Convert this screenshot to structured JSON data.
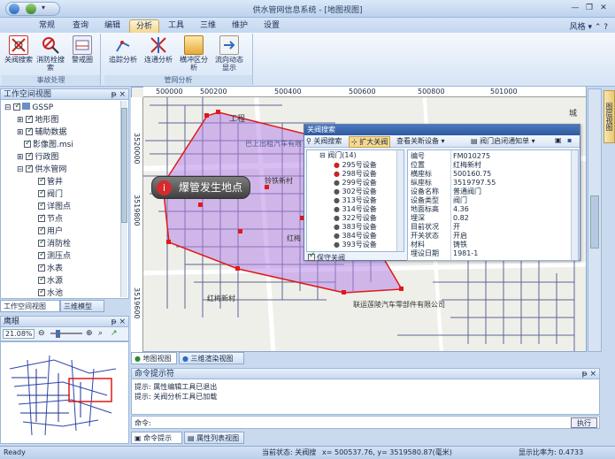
{
  "window": {
    "title": "供水管网信息系统 - [地图视图]",
    "style_label": "风格",
    "controls": [
      "—",
      "❐",
      "✕"
    ]
  },
  "menu": {
    "tabs": [
      "常规",
      "查询",
      "编辑",
      "分析",
      "工具",
      "三维",
      "维护",
      "设置"
    ],
    "active": "分析"
  },
  "ribbon": {
    "groups": [
      {
        "label": "事故处理",
        "buttons": [
          "关阀搜索",
          "消防栓搜索",
          "警戒圈"
        ]
      },
      {
        "label": "管网分析",
        "buttons": [
          "追踪分析",
          "连通分析",
          "横冲区分析",
          "流向动态显示"
        ]
      }
    ]
  },
  "workspace": {
    "title": "工作空间视图",
    "tree": [
      {
        "label": "GSSP",
        "level": 0
      },
      {
        "label": "地形图",
        "level": 1
      },
      {
        "label": "辅助数据",
        "level": 1
      },
      {
        "label": "影像图.msi",
        "level": 1
      },
      {
        "label": "行政图",
        "level": 1
      },
      {
        "label": "供水管网",
        "level": 1
      },
      {
        "label": "管井",
        "level": 2
      },
      {
        "label": "阀门",
        "level": 2
      },
      {
        "label": "详图点",
        "level": 2
      },
      {
        "label": "节点",
        "level": 2
      },
      {
        "label": "用户",
        "level": 2
      },
      {
        "label": "消防栓",
        "level": 2
      },
      {
        "label": "测压点",
        "level": 2
      },
      {
        "label": "水表",
        "level": 2
      },
      {
        "label": "水源",
        "level": 2
      },
      {
        "label": "水池",
        "level": 2
      }
    ],
    "tabs": [
      "工作空间视图",
      "三维模型"
    ]
  },
  "eagle": {
    "title": "鹰眼",
    "zoom": "21.08%"
  },
  "map": {
    "ruler_top": [
      "500000",
      "500200",
      "500400",
      "500600",
      "500800",
      "501000"
    ],
    "ruler_left": [
      "3520000",
      "3519800",
      "3519600"
    ],
    "labels": [
      "工程",
      "巴上出租汽车有限",
      "铃铁新村",
      "红梅",
      "红梅新村",
      "联运莲陵汽车零部件有限公司",
      "城"
    ],
    "callout": "爆管发生地点"
  },
  "dialog": {
    "title": "关阀搜索",
    "toolbar": {
      "search": "关阀搜索",
      "expand": "扩大关阀",
      "query": "查看关断设备",
      "notice": "阀门启闭通知单"
    },
    "tree": {
      "root": "阀门(14)",
      "items": [
        "295号设备",
        "298号设备",
        "299号设备",
        "302号设备",
        "313号设备",
        "314号设备",
        "322号设备",
        "383号设备",
        "384号设备",
        "393号设备"
      ]
    },
    "props": [
      {
        "k": "编号",
        "v": "FM010275"
      },
      {
        "k": "位置",
        "v": "红梅新村"
      },
      {
        "k": "横座标",
        "v": "500160.75"
      },
      {
        "k": "纵座标",
        "v": "3519797.55"
      },
      {
        "k": "设备名称",
        "v": "普通阀门"
      },
      {
        "k": "设备类型",
        "v": "阀门"
      },
      {
        "k": "地面标高",
        "v": "4.36"
      },
      {
        "k": "埋深",
        "v": "0.82"
      },
      {
        "k": "目前状况",
        "v": "开"
      },
      {
        "k": "开关状态",
        "v": "开启"
      },
      {
        "k": "材料",
        "v": "铸铁"
      },
      {
        "k": "埋设日期",
        "v": "1981-1"
      }
    ],
    "keep_label": "保守关阀"
  },
  "view_tabs": [
    "地图视图",
    "三维渲染视图"
  ],
  "cmd": {
    "title": "命令提示符",
    "lines": [
      "提示: 属性编辑工具已退出",
      "提示: 关阀分析工具已加载"
    ],
    "input_label": "命令:",
    "run": "执行"
  },
  "bottom_tabs": [
    "命令提示符",
    "属性列表视图"
  ],
  "right_tab": "图层视图",
  "status": {
    "left": "Ready",
    "state": "当前状态: 关阀搜",
    "coords": "x= 500537.76, y= 3519580.87(毫米)",
    "scale": "显示比率为: 0.4733"
  }
}
